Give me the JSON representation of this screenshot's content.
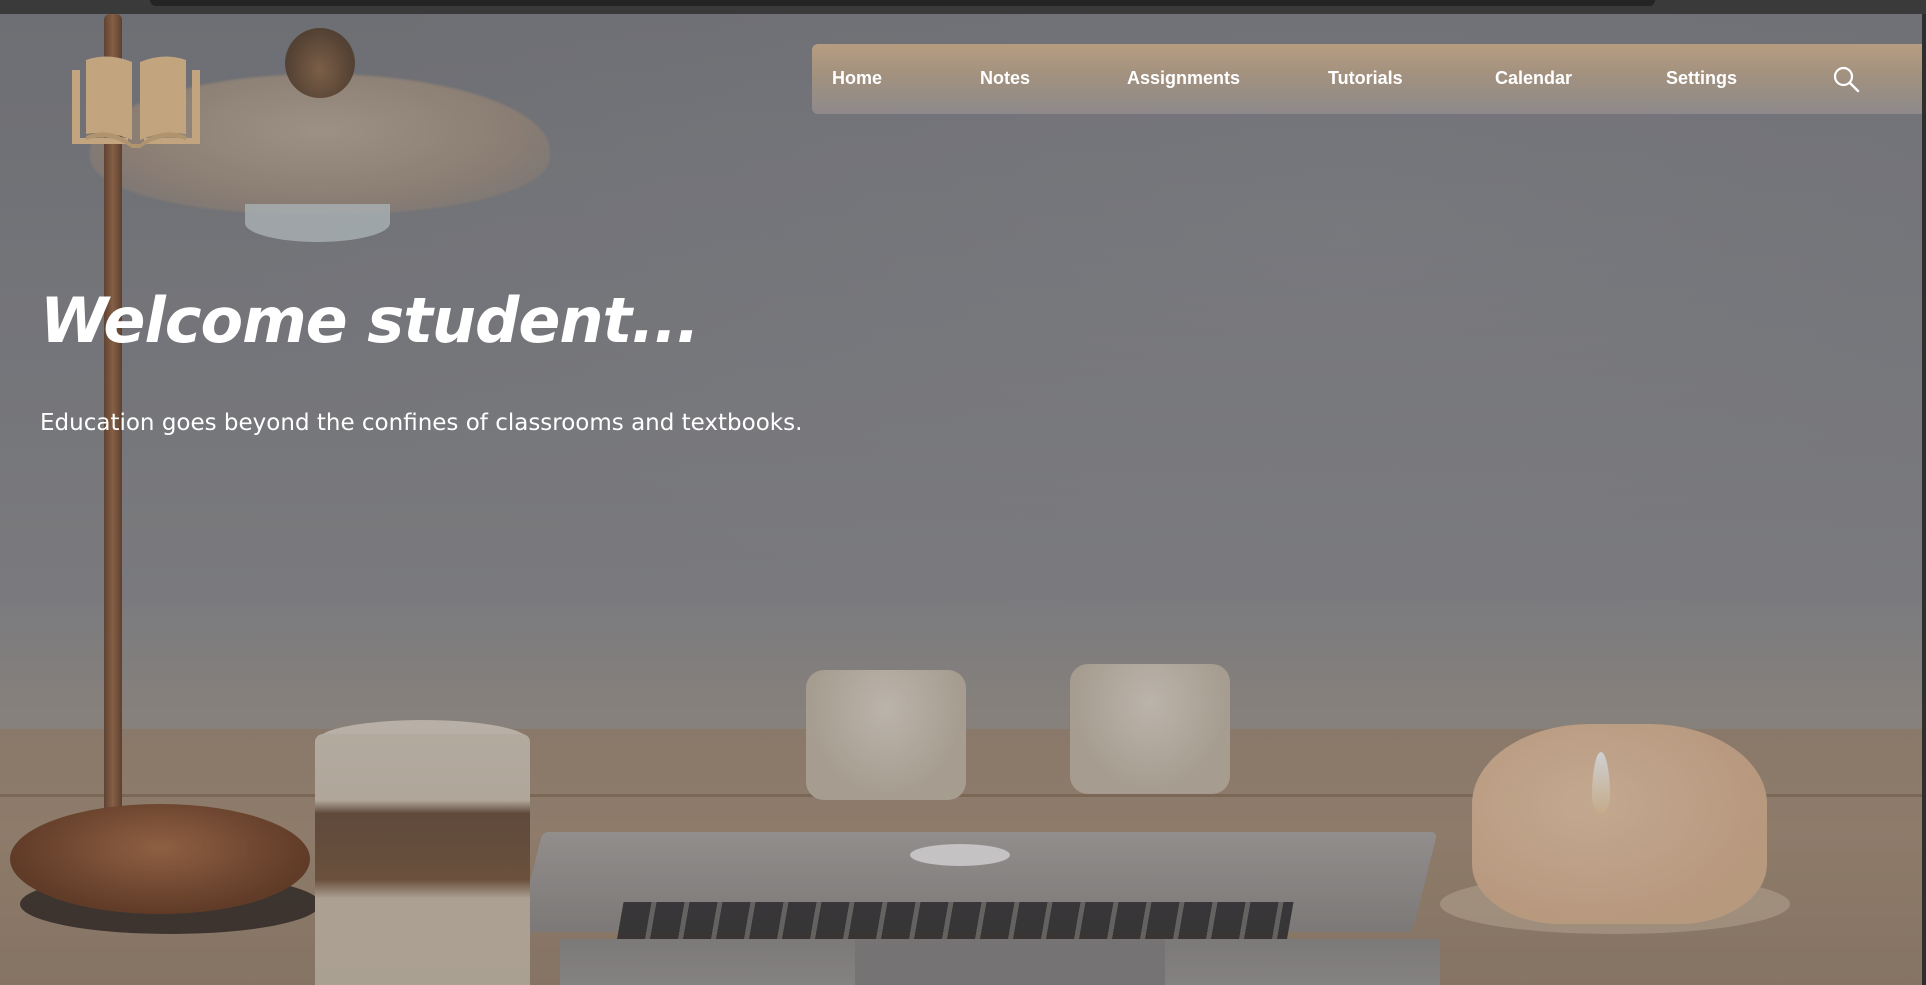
{
  "nav": {
    "items": [
      {
        "label": "Home"
      },
      {
        "label": "Notes"
      },
      {
        "label": "Assignments"
      },
      {
        "label": "Tutorials"
      },
      {
        "label": "Calendar"
      },
      {
        "label": "Settings"
      }
    ],
    "search_icon": "search-icon"
  },
  "hero": {
    "title": "Welcome student...",
    "subtitle": "Education goes beyond the confines of classrooms and textbooks."
  },
  "logo": {
    "icon": "open-book-icon"
  },
  "colors": {
    "accent": "#c2a47f",
    "nav_gradient_top": "#b69d80",
    "text": "#ffffff"
  }
}
